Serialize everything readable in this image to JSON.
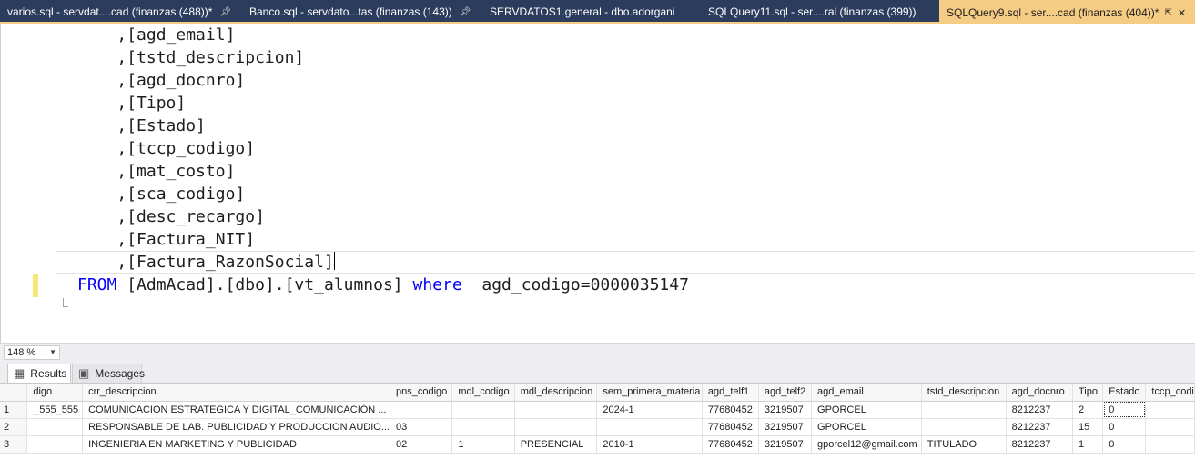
{
  "tabs": [
    {
      "label": "varios.sql - servdat....cad (finanzas (488))*",
      "pinned": true
    },
    {
      "label": "Banco.sql - servdato...tas (finanzas (143))",
      "pinned": true
    },
    {
      "label": "SERVDATOS1.general - dbo.adorgani",
      "pinned": false
    },
    {
      "label": "SQLQuery11.sql - ser....ral (finanzas (399))",
      "pinned": false
    },
    {
      "label": "SQLQuery9.sql - ser....cad (finanzas (404))*",
      "pinned": true,
      "active": true
    }
  ],
  "editor": {
    "lines": [
      ",[agd_email]",
      ",[tstd_descripcion]",
      ",[agd_docnro]",
      ",[Tipo]",
      ",[Estado]",
      ",[tccp_codigo]",
      ",[mat_costo]",
      ",[sca_codigo]",
      ",[desc_recargo]",
      ",[Factura_NIT]",
      ",[Factura_RazonSocial]"
    ],
    "query": {
      "from_kw": "FROM",
      "table": "[AdmAcad].[dbo].[vt_alumnos]",
      "where_kw": "where",
      "condition": "agd_codigo=0000035147"
    }
  },
  "zoom": "148 %",
  "results_tabs": {
    "results": "Results",
    "messages": "Messages"
  },
  "grid": {
    "columns": [
      "digo",
      "crr_descripcion",
      "pns_codigo",
      "mdl_codigo",
      "mdl_descripcion",
      "sem_primera_materia",
      "agd_telf1",
      "agd_telf2",
      "agd_email",
      "tstd_descripcion",
      "agd_docnro",
      "Tipo",
      "Estado",
      "tccp_codi"
    ],
    "rows": [
      {
        "num": "1",
        "cells": [
          "555_555_",
          "COMUNICACION ESTRATEGICA Y DIGITAL_COMUNICACIÓN ...",
          "",
          "",
          "",
          "2024-1",
          "77680452",
          "3219507",
          "GPORCEL",
          "",
          "8212237",
          "2",
          "0",
          ""
        ]
      },
      {
        "num": "2",
        "cells": [
          "",
          "RESPONSABLE DE LAB. PUBLICIDAD Y PRODUCCION AUDIO...",
          "03",
          "",
          "",
          "",
          "77680452",
          "3219507",
          "GPORCEL",
          "",
          "8212237",
          "15",
          "0",
          ""
        ]
      },
      {
        "num": "3",
        "cells": [
          "",
          "INGENIERIA EN MARKETING Y PUBLICIDAD",
          "02",
          "1",
          "PRESENCIAL",
          "2010-1",
          "77680452",
          "3219507",
          "gporcel12@gmail.com",
          "TITULADO",
          "8212237",
          "1",
          "0",
          ""
        ]
      }
    ]
  },
  "colors": {
    "tabbar": "#2b3c5c",
    "active_tab": "#f5cc84",
    "keyword": "#0000ff",
    "change_marker": "#f7e67a"
  }
}
